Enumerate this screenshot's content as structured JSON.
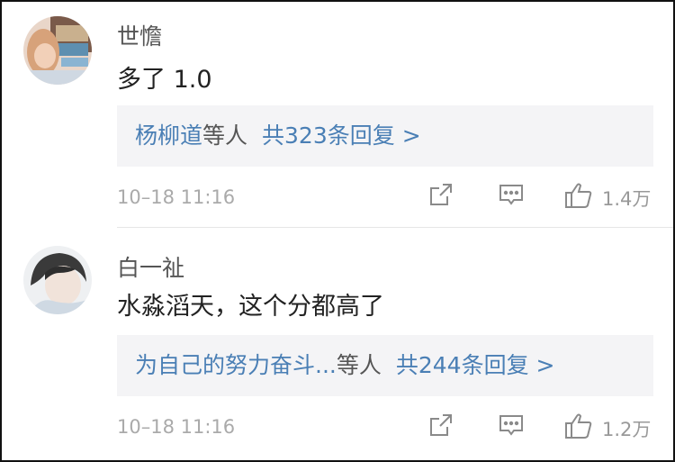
{
  "comments": [
    {
      "username": "世憺",
      "text": "多了 1.0",
      "reply_users": "杨柳道",
      "reply_suffix": "等人",
      "reply_count": "共323条回复 >",
      "time": "10–18 11:16",
      "likes": "1.4万"
    },
    {
      "username": "白一祉",
      "text": "水淼滔天，这个分都高了",
      "reply_users": "为自己的努力奋斗...",
      "reply_suffix": "等人",
      "reply_count": "共244条回复 >",
      "time": "10–18 11:16",
      "likes": "1.2万"
    }
  ],
  "colors": {
    "link": "#4a7fb5",
    "reply_bg": "#f4f4f6",
    "meta": "#aaaaaa"
  },
  "icons": [
    "share-icon",
    "comment-icon",
    "thumbs-up-icon"
  ]
}
